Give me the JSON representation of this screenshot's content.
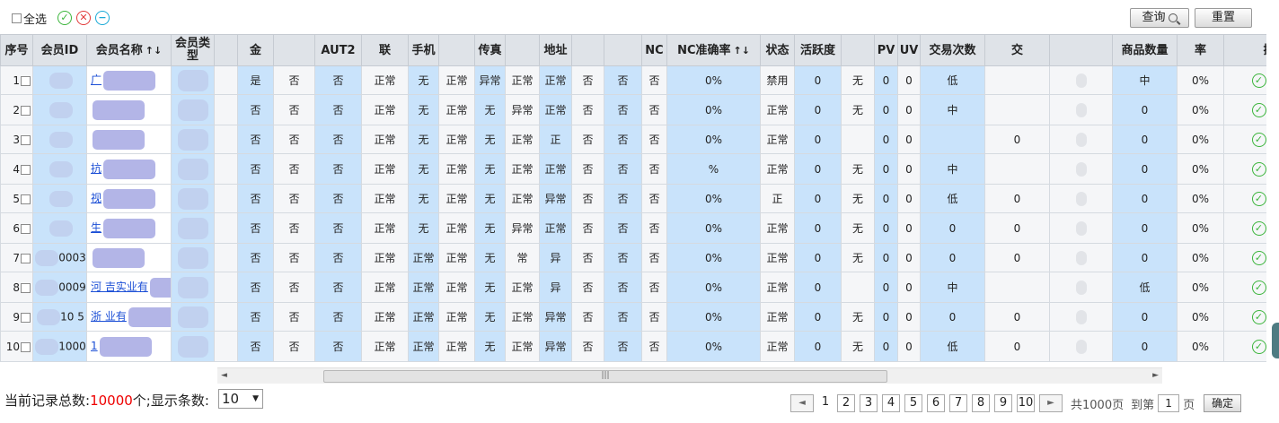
{
  "toolbar": {
    "select_all_label": "全选",
    "icons": [
      "check-circle-icon",
      "x-circle-icon",
      "minus-circle-icon"
    ],
    "query_label": "查询",
    "reset_label": "重置"
  },
  "table": {
    "columns": [
      "序号",
      "会员ID",
      "会员名称",
      "会员类型",
      "",
      "金",
      "",
      "AUT2",
      "联",
      "手机",
      "",
      "传真",
      "",
      "地址",
      "",
      "",
      "NC",
      "NC准确率",
      "状态",
      "活跃度",
      "",
      "PV",
      "UV",
      "交易次数",
      "交",
      "",
      "商品数量",
      "率",
      "操作"
    ],
    "rows": [
      {
        "idx": "1",
        "c5": "是",
        "c6": "否",
        "c7": "否",
        "c8": "正常",
        "c9": "无",
        "c10": "正常",
        "c11": "异常",
        "c12": "正常",
        "c13": "正常",
        "c14": "否",
        "c15": "否",
        "c16": "否",
        "c17": "0%",
        "c18": "禁用",
        "c19": "0",
        "c20": "无",
        "c21": "0",
        "c22": "0",
        "c23": "低",
        "c24": "",
        "c26": "中",
        "c27": "0%"
      },
      {
        "idx": "2",
        "c5": "否",
        "c6": "否",
        "c7": "否",
        "c8": "正常",
        "c9": "无",
        "c10": "正常",
        "c11": "无",
        "c12": "异常",
        "c13": "正常",
        "c14": "否",
        "c15": "否",
        "c16": "否",
        "c17": "0%",
        "c18": "正常",
        "c19": "0",
        "c20": "无",
        "c21": "0",
        "c22": "0",
        "c23": "中",
        "c24": "",
        "c26": "0",
        "c27": "0%"
      },
      {
        "idx": "3",
        "c5": "否",
        "c6": "否",
        "c7": "否",
        "c8": "正常",
        "c9": "无",
        "c10": "正常",
        "c11": "无",
        "c12": "正常",
        "c13": "正",
        "c14": "否",
        "c15": "否",
        "c16": "否",
        "c17": "0%",
        "c18": "正常",
        "c19": "0",
        "c20": "",
        "c21": "0",
        "c22": "0",
        "c23": "",
        "c24": "0",
        "c26": "0",
        "c27": "0%"
      },
      {
        "idx": "4",
        "c5": "否",
        "c6": "否",
        "c7": "否",
        "c8": "正常",
        "c9": "无",
        "c10": "正常",
        "c11": "无",
        "c12": "正常",
        "c13": "正常",
        "c14": "否",
        "c15": "否",
        "c16": "否",
        "c17": "%",
        "c18": "正常",
        "c19": "0",
        "c20": "无",
        "c21": "0",
        "c22": "0",
        "c23": "中",
        "c24": "",
        "c26": "0",
        "c27": "0%"
      },
      {
        "idx": "5",
        "c5": "否",
        "c6": "否",
        "c7": "否",
        "c8": "正常",
        "c9": "无",
        "c10": "正常",
        "c11": "无",
        "c12": "正常",
        "c13": "异常",
        "c14": "否",
        "c15": "否",
        "c16": "否",
        "c17": "0%",
        "c18": "正",
        "c19": "0",
        "c20": "无",
        "c21": "0",
        "c22": "0",
        "c23": "低",
        "c24": "0",
        "c26": "0",
        "c27": "0%"
      },
      {
        "idx": "6",
        "c5": "否",
        "c6": "否",
        "c7": "否",
        "c8": "正常",
        "c9": "无",
        "c10": "正常",
        "c11": "无",
        "c12": "异常",
        "c13": "正常",
        "c14": "否",
        "c15": "否",
        "c16": "否",
        "c17": "0%",
        "c18": "正常",
        "c19": "0",
        "c20": "无",
        "c21": "0",
        "c22": "0",
        "c23": "0",
        "c24": "0",
        "c26": "0",
        "c27": "0%"
      },
      {
        "idx": "7",
        "c5": "否",
        "c6": "否",
        "c7": "否",
        "c8": "正常",
        "c9": "正常",
        "c10": "正常",
        "c11": "无",
        "c12": "常",
        "c13": "异",
        "c14": "否",
        "c15": "否",
        "c16": "否",
        "c17": "0%",
        "c18": "正常",
        "c19": "0",
        "c20": "无",
        "c21": "0",
        "c22": "0",
        "c23": "0",
        "c24": "0",
        "c26": "0",
        "c27": "0%"
      },
      {
        "idx": "8",
        "c5": "否",
        "c6": "否",
        "c7": "否",
        "c8": "正常",
        "c9": "正常",
        "c10": "正常",
        "c11": "无",
        "c12": "正常",
        "c13": "异",
        "c14": "否",
        "c15": "否",
        "c16": "否",
        "c17": "0%",
        "c18": "正常",
        "c19": "0",
        "c20": "",
        "c21": "0",
        "c22": "0",
        "c23": "中",
        "c24": "",
        "c26": "低",
        "c27": "0%"
      },
      {
        "idx": "9",
        "c5": "否",
        "c6": "否",
        "c7": "否",
        "c8": "正常",
        "c9": "正常",
        "c10": "正常",
        "c11": "无",
        "c12": "正常",
        "c13": "异常",
        "c14": "否",
        "c15": "否",
        "c16": "否",
        "c17": "0%",
        "c18": "正常",
        "c19": "0",
        "c20": "无",
        "c21": "0",
        "c22": "0",
        "c23": "0",
        "c24": "0",
        "c26": "0",
        "c27": "0%"
      },
      {
        "idx": "10",
        "c5": "否",
        "c6": "否",
        "c7": "否",
        "c8": "正常",
        "c9": "正常",
        "c10": "正常",
        "c11": "无",
        "c12": "正常",
        "c13": "异常",
        "c14": "否",
        "c15": "否",
        "c16": "否",
        "c17": "0%",
        "c18": "正常",
        "c19": "0",
        "c20": "无",
        "c21": "0",
        "c22": "0",
        "c23": "低",
        "c24": "0",
        "c26": "0",
        "c27": "0%"
      }
    ],
    "row_ids": [
      "",
      "",
      "",
      "",
      "",
      "",
      "0003",
      "0009",
      "10   5",
      "1000"
    ],
    "row_names": [
      "广",
      "",
      "",
      "抗",
      "视",
      "生",
      "",
      "河      吉实业有",
      "浙      业有",
      "1"
    ]
  },
  "footer": {
    "total_prefix": "当前记录总数:",
    "total_count": "10000",
    "total_suffix": "个;显示条数:",
    "page_size": "10",
    "pages": [
      "1",
      "2",
      "3",
      "4",
      "5",
      "6",
      "7",
      "8",
      "9",
      "10"
    ],
    "total_pages": "共1000页",
    "goto_prefix": "到第",
    "goto_value": "1",
    "goto_suffix": "页",
    "confirm_label": "确定"
  },
  "colors": {
    "row_highlight": "#c9e3fb",
    "header_bg": "#dfe3e8",
    "link": "#1c4fd6",
    "count_red": "#ee0000"
  }
}
